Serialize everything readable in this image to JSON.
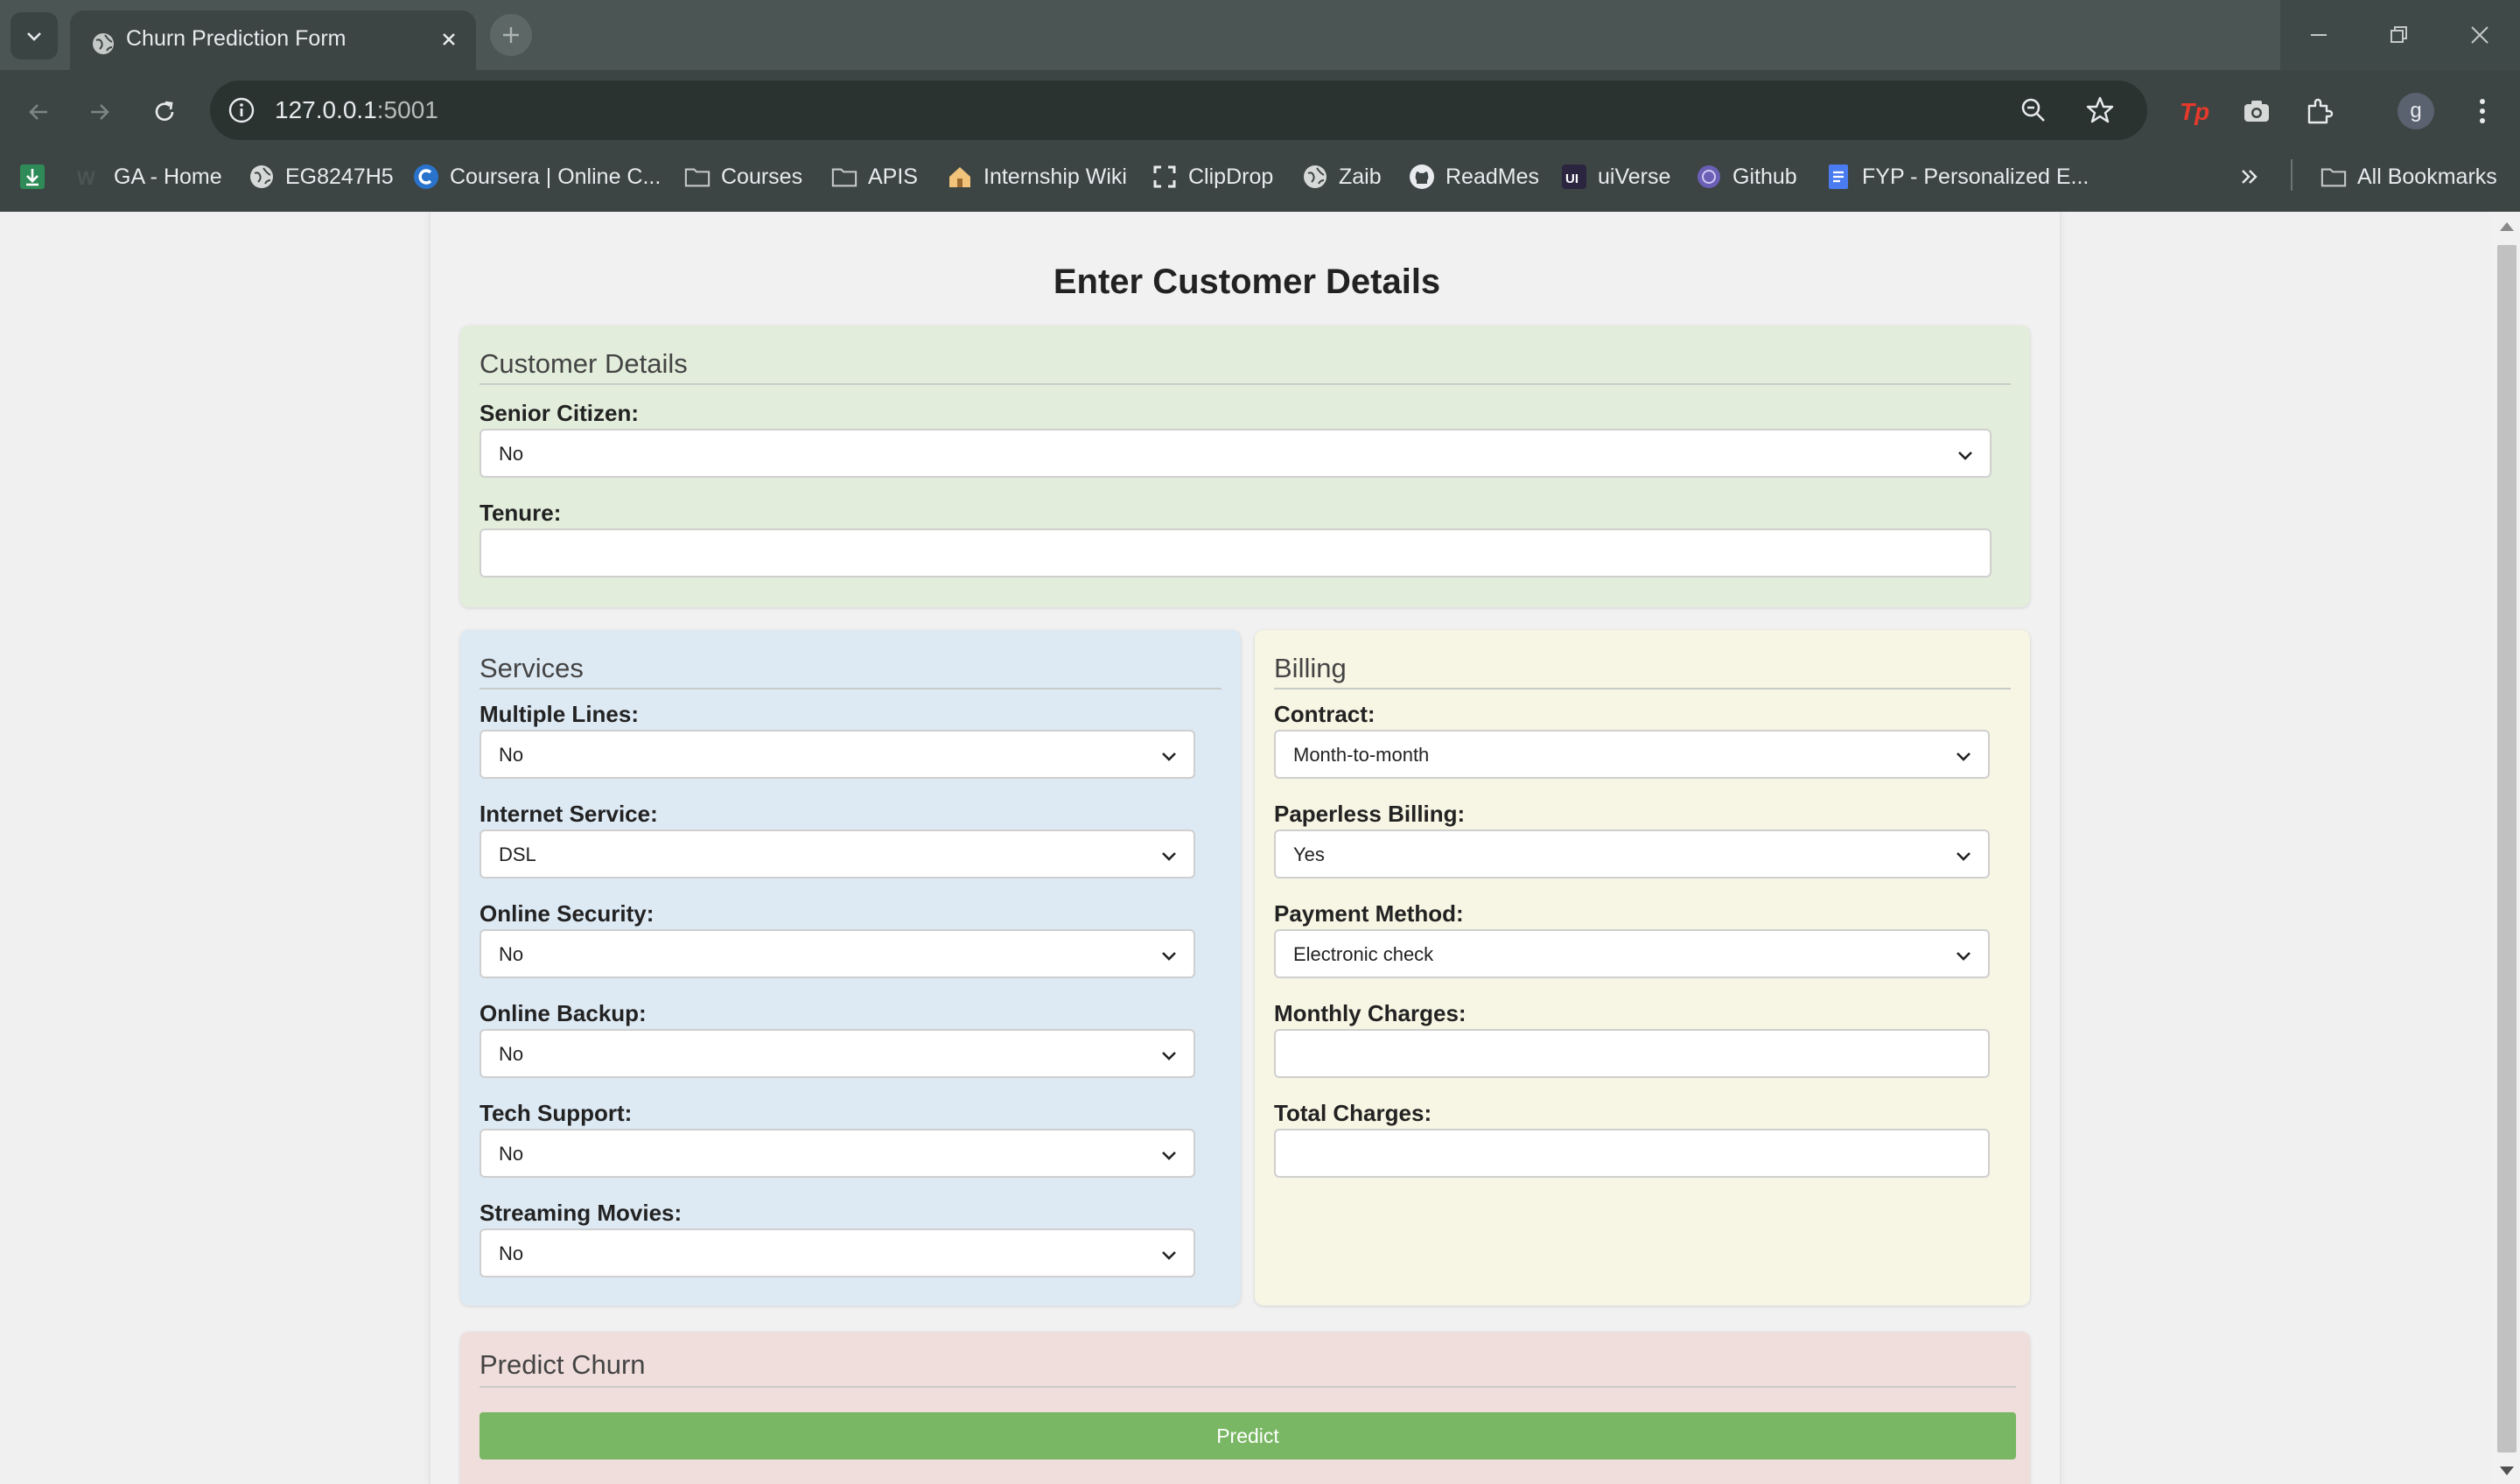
{
  "browser": {
    "tab_title": "Churn Prediction Form",
    "url_host": "127.0.0.1",
    "url_port": ":5001",
    "profile_initial": "g",
    "bookmarks": [
      {
        "label": "",
        "icon": "download-green-icon"
      },
      {
        "label": "GA - Home",
        "icon": "ga-icon"
      },
      {
        "label": "EG8247H5",
        "icon": "globe-icon"
      },
      {
        "label": "Coursera | Online C...",
        "icon": "coursera-icon"
      },
      {
        "label": "Courses",
        "icon": "folder-icon"
      },
      {
        "label": "APIS",
        "icon": "folder-icon"
      },
      {
        "label": "Internship Wiki",
        "icon": "home-icon"
      },
      {
        "label": "ClipDrop",
        "icon": "clipdrop-icon"
      },
      {
        "label": "Zaib",
        "icon": "globe-icon"
      },
      {
        "label": "ReadMes",
        "icon": "github-icon"
      },
      {
        "label": "uiVerse",
        "icon": "uiverse-icon"
      },
      {
        "label": "Github",
        "icon": "github-purple-icon"
      },
      {
        "label": "FYP - Personalized E...",
        "icon": "docs-icon"
      }
    ],
    "all_bookmarks_label": "All Bookmarks"
  },
  "form": {
    "title": "Enter Customer Details",
    "customer": {
      "heading": "Customer Details",
      "senior_citizen": {
        "label": "Senior Citizen:",
        "value": "No"
      },
      "tenure": {
        "label": "Tenure:",
        "value": ""
      }
    },
    "services": {
      "heading": "Services",
      "multiple_lines": {
        "label": "Multiple Lines:",
        "value": "No"
      },
      "internet_service": {
        "label": "Internet Service:",
        "value": "DSL"
      },
      "online_security": {
        "label": "Online Security:",
        "value": "No"
      },
      "online_backup": {
        "label": "Online Backup:",
        "value": "No"
      },
      "tech_support": {
        "label": "Tech Support:",
        "value": "No"
      },
      "streaming_movies": {
        "label": "Streaming Movies:",
        "value": "No"
      }
    },
    "billing": {
      "heading": "Billing",
      "contract": {
        "label": "Contract:",
        "value": "Month-to-month"
      },
      "paperless_billing": {
        "label": "Paperless Billing:",
        "value": "Yes"
      },
      "payment_method": {
        "label": "Payment Method:",
        "value": "Electronic check"
      },
      "monthly_charges": {
        "label": "Monthly Charges:",
        "value": ""
      },
      "total_charges": {
        "label": "Total Charges:",
        "value": ""
      }
    },
    "predict": {
      "heading": "Predict Churn",
      "button_label": "Predict"
    }
  },
  "colors": {
    "customer_bg": "#e2eddb",
    "services_bg": "#dde9f3",
    "billing_bg": "#f7f5e3",
    "predict_bg": "#efdedb",
    "predict_button": "#79b764"
  }
}
